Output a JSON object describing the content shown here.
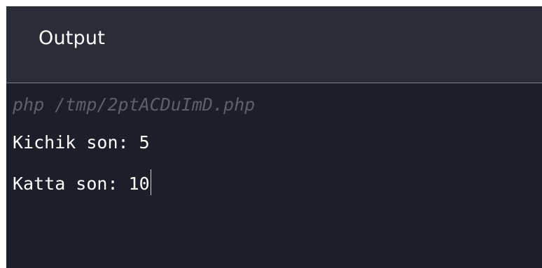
{
  "panel": {
    "title": "Output"
  },
  "console": {
    "command": "php /tmp/2ptACDuImD.php",
    "lines": [
      "Kichik son: 5",
      "Katta son: 10"
    ]
  }
}
